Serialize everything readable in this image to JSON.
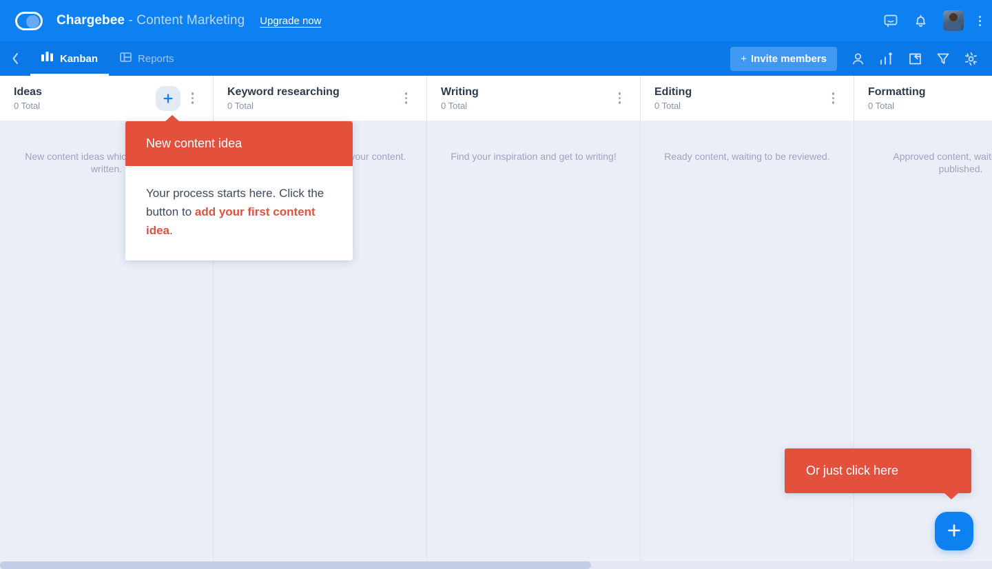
{
  "colors": {
    "top_bar_blue": "#0d80f2",
    "sub_bar_blue": "#0b78e8",
    "board_bg": "#ebeef7",
    "tooltip_red": "#e3503c",
    "accent_blue": "#0d80f2"
  },
  "topbar": {
    "logo_icon": "chargebee-toggle-logo",
    "brand": "Chargebee",
    "project_suffix": " - Content Marketing",
    "upgrade_label": "Upgrade now",
    "icons": [
      {
        "name": "chat-bubble-icon",
        "label": "Messages"
      },
      {
        "name": "bell-icon",
        "label": "Notifications"
      }
    ],
    "avatar_name": "user-avatar",
    "overflow_name": "topbar-overflow-menu"
  },
  "subbar": {
    "back_icon": "chevron-left-icon",
    "tabs": [
      {
        "label": "Kanban",
        "icon": "kanban-columns-icon",
        "active": true
      },
      {
        "label": "Reports",
        "icon": "reports-panel-icon",
        "active": false
      }
    ],
    "invite": {
      "plus": "+",
      "label": "Invite members"
    },
    "icons": [
      {
        "name": "person-icon",
        "label": "Members"
      },
      {
        "name": "bar-chart-icon",
        "label": "Analytics"
      },
      {
        "name": "archive-clock-icon",
        "label": "Archive"
      },
      {
        "name": "filter-funnel-icon",
        "label": "Filter"
      },
      {
        "name": "gear-icon",
        "label": "Settings"
      }
    ]
  },
  "board": {
    "columns": [
      {
        "name": "Ideas",
        "total": "0 Total",
        "hint": "New content ideas which are yet to be written.",
        "has_add_button": true
      },
      {
        "name": "Keyword researching",
        "total": "0 Total",
        "hint": "Find the right keywords for your content.",
        "has_add_button": false
      },
      {
        "name": "Writing",
        "total": "0 Total",
        "hint": "Find your inspiration and get to writing!",
        "has_add_button": false
      },
      {
        "name": "Editing",
        "total": "0 Total",
        "hint": "Ready content, waiting to be reviewed.",
        "has_add_button": false
      },
      {
        "name": "Formatting",
        "total": "0 Total",
        "hint": "Approved content, waiting to be published.",
        "has_add_button": false
      }
    ]
  },
  "tooltips": {
    "ideas": {
      "title": "New content idea",
      "body_before": "Your process starts here. Click the button to ",
      "body_highlight": "add your first content idea",
      "body_after": "."
    },
    "fab": {
      "label": "Or just click here"
    }
  },
  "fab": {
    "icon": "plus-icon",
    "label": "Add card"
  },
  "scrollbar": {
    "orientation": "horizontal",
    "thumb_width_px": "858"
  }
}
